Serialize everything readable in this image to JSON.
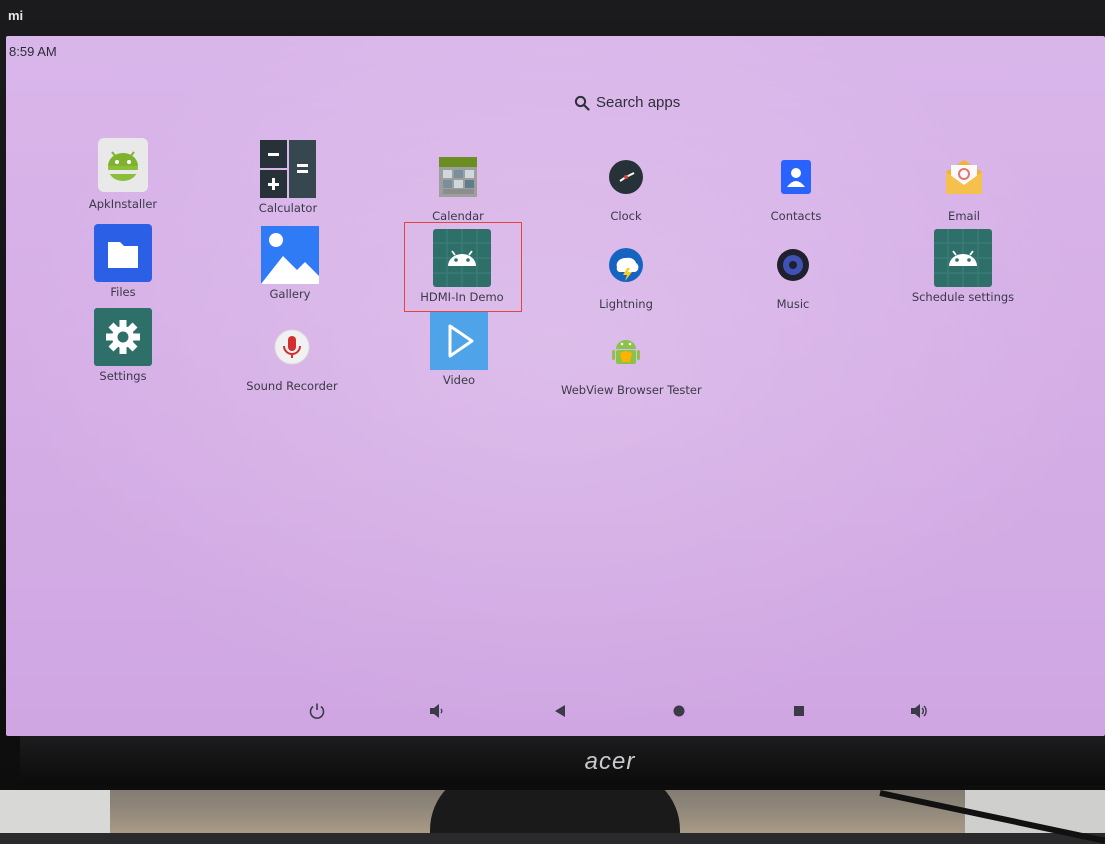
{
  "monitor": {
    "brand": "acer",
    "corner_label": "mi"
  },
  "status_bar": {
    "time": "8:59 AM"
  },
  "search": {
    "label": "Search apps",
    "icon": "search-icon"
  },
  "apps": [
    {
      "label": "ApkInstaller",
      "icon": "apk-installer-icon"
    },
    {
      "label": "Calculator",
      "icon": "calculator-icon"
    },
    {
      "label": "Calendar",
      "icon": "calendar-icon"
    },
    {
      "label": "Clock",
      "icon": "clock-icon"
    },
    {
      "label": "Contacts",
      "icon": "contacts-icon"
    },
    {
      "label": "Email",
      "icon": "email-icon"
    },
    {
      "label": "Files",
      "icon": "files-icon"
    },
    {
      "label": "Gallery",
      "icon": "gallery-icon"
    },
    {
      "label": "HDMI-In Demo",
      "icon": "android-icon",
      "highlighted": true
    },
    {
      "label": "Lightning",
      "icon": "lightning-icon"
    },
    {
      "label": "Music",
      "icon": "music-icon"
    },
    {
      "label": "Schedule settings",
      "icon": "android-icon"
    },
    {
      "label": "Settings",
      "icon": "settings-gear-icon"
    },
    {
      "label": "Sound Recorder",
      "icon": "microphone-icon"
    },
    {
      "label": "Video",
      "icon": "play-icon"
    },
    {
      "label": "WebView Browser Tester",
      "icon": "webview-android-icon"
    }
  ],
  "navbar": [
    {
      "icon": "power-icon"
    },
    {
      "icon": "volume-down-icon"
    },
    {
      "icon": "back-icon"
    },
    {
      "icon": "home-icon"
    },
    {
      "icon": "recents-icon"
    },
    {
      "icon": "volume-up-icon"
    }
  ],
  "colors": {
    "highlight": "#e0463f",
    "screen_bg": "#d5aee6",
    "android_tile": "#2f6f6a"
  }
}
